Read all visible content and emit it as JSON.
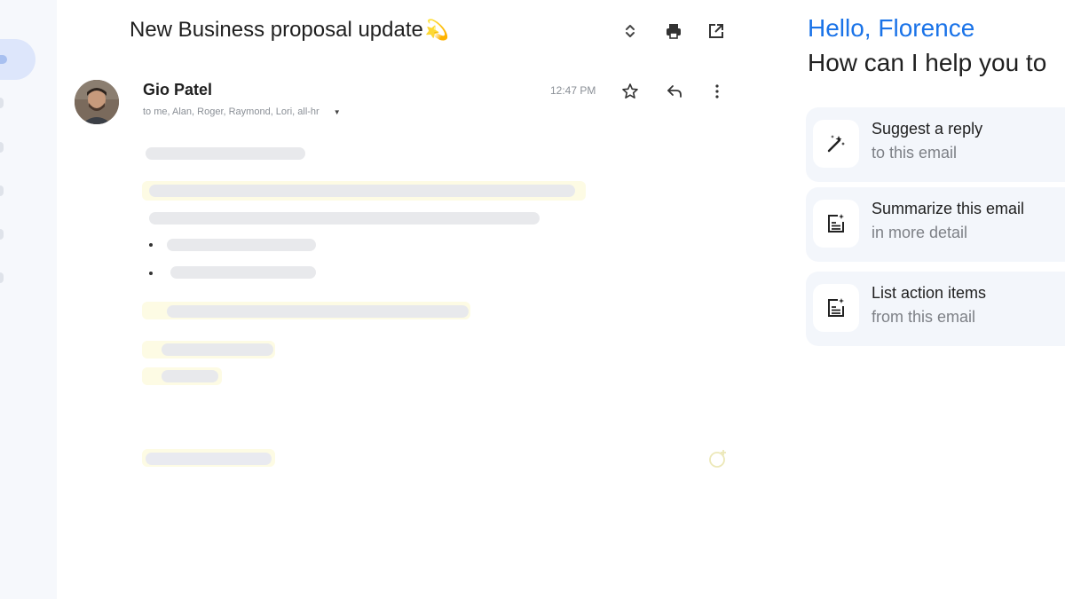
{
  "email": {
    "subject": "New Business proposal update",
    "subject_emoji": "💫",
    "sender": "Gio Patel",
    "recipients": "to me, Alan, Roger, Raymond, Lori, all-hr",
    "time": "12:47 PM"
  },
  "assistant": {
    "greeting": "Hello, Florence",
    "prompt": "How can I help you to",
    "suggestions": [
      {
        "title": "Suggest a reply",
        "subtitle": "to this email",
        "icon": "magic-pen-icon"
      },
      {
        "title": "Summarize this email",
        "subtitle": "in more detail",
        "icon": "document-sparkle-icon"
      },
      {
        "title": "List action items",
        "subtitle": "from this email",
        "icon": "document-sparkle-icon"
      }
    ]
  },
  "colors": {
    "accent": "#1a73e8",
    "rail_bg": "#f6f8fc",
    "card_bg": "#f3f6fb",
    "highlight": "#fdfbe4"
  }
}
